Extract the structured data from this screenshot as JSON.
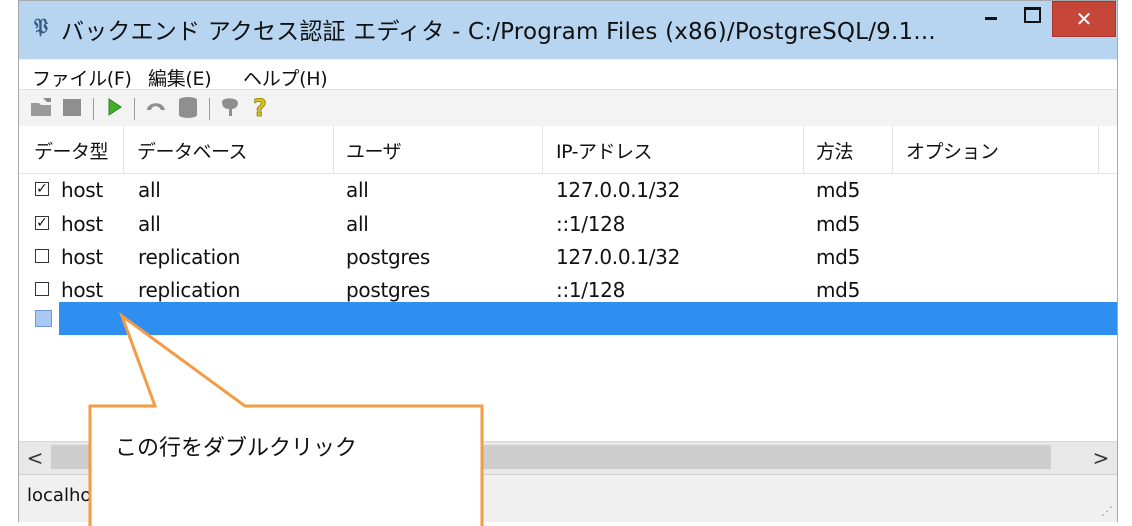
{
  "window": {
    "title": "バックエンド アクセス認証 エディタ - C:/Program Files (x86)/PostgreSQL/9.1...",
    "app_icon": "elephant-icon",
    "controls": {
      "minimize": "minimize-icon",
      "maximize": "maximize-icon",
      "close": "✕"
    }
  },
  "menu": [
    "ファイル(F)",
    "編集(E)",
    "ヘルプ(H)"
  ],
  "toolbar": [
    "open-icon",
    "stop-icon",
    "run-icon",
    "undo-icon",
    "database-icon",
    "elephant-icon",
    "help-icon"
  ],
  "grid": {
    "columns": [
      "データ型",
      "データベース",
      "ユーザ",
      "IP-アドレス",
      "方法",
      "オプション"
    ],
    "rows": [
      {
        "checked": true,
        "type": "host",
        "database": "all",
        "user": "all",
        "address": "127.0.0.1/32",
        "method": "md5",
        "option": ""
      },
      {
        "checked": true,
        "type": "host",
        "database": "all",
        "user": "all",
        "address": "::1/128",
        "method": "md5",
        "option": ""
      },
      {
        "checked": false,
        "type": "host",
        "database": "replication",
        "user": "postgres",
        "address": "127.0.0.1/32",
        "method": "md5",
        "option": ""
      },
      {
        "checked": false,
        "type": "host",
        "database": "replication",
        "user": "postgres",
        "address": "::1/128",
        "method": "md5",
        "option": ""
      }
    ],
    "new_row_selected": true
  },
  "scrollbar": {
    "left": "<",
    "right": ">"
  },
  "status": {
    "text": "localho"
  },
  "callout": {
    "text": "この行をダブルクリック",
    "color": "#f39b45"
  },
  "colors": {
    "selection": "#2f8ff1",
    "titlebar": "#b7d4f0",
    "close": "#c7463a"
  }
}
